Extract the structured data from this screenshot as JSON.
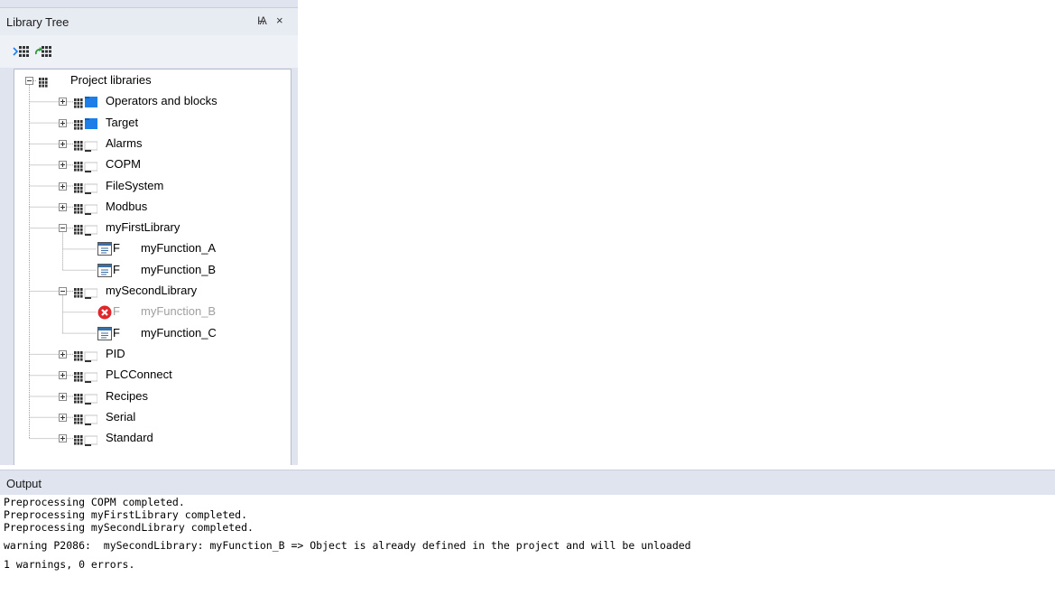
{
  "library_tree": {
    "title": "Library Tree",
    "pin_glyph": "Ѩ",
    "close_glyph": "×",
    "toolbar": [
      {
        "icon": "import-library-icon"
      },
      {
        "icon": "refresh-library-icon"
      }
    ],
    "root": {
      "label": "Project libraries",
      "expanded": true
    },
    "items": [
      {
        "label": "Operators and blocks",
        "state": "collapsed",
        "icon": "library-blue"
      },
      {
        "label": "Target",
        "state": "collapsed",
        "icon": "library-blue"
      },
      {
        "label": "Alarms",
        "state": "collapsed",
        "icon": "library-gray"
      },
      {
        "label": "COPM",
        "state": "collapsed",
        "icon": "library-gray"
      },
      {
        "label": "FileSystem",
        "state": "collapsed",
        "icon": "library-gray"
      },
      {
        "label": "Modbus",
        "state": "collapsed",
        "icon": "library-gray"
      },
      {
        "label": "myFirstLibrary",
        "state": "expanded",
        "icon": "library-gray",
        "children": [
          {
            "label": "myFunction_A",
            "kind": "F",
            "status": "ok"
          },
          {
            "label": "myFunction_B",
            "kind": "F",
            "status": "ok"
          }
        ]
      },
      {
        "label": "mySecondLibrary",
        "state": "expanded",
        "icon": "library-gray",
        "children": [
          {
            "label": "myFunction_B",
            "kind": "F",
            "status": "error"
          },
          {
            "label": "myFunction_C",
            "kind": "F",
            "status": "ok"
          }
        ]
      },
      {
        "label": "PID",
        "state": "collapsed",
        "icon": "library-gray"
      },
      {
        "label": "PLCConnect",
        "state": "collapsed",
        "icon": "library-gray"
      },
      {
        "label": "Recipes",
        "state": "collapsed",
        "icon": "library-gray"
      },
      {
        "label": "Serial",
        "state": "collapsed",
        "icon": "library-gray"
      },
      {
        "label": "Standard",
        "state": "collapsed",
        "icon": "library-gray"
      }
    ]
  },
  "output": {
    "title": "Output",
    "lines": [
      "Preprocessing COPM completed.",
      "Preprocessing myFirstLibrary completed.",
      "Preprocessing mySecondLibrary completed.",
      "",
      "warning P2086:  mySecondLibrary: myFunction_B => Object is already defined in the project and will be unloaded",
      "",
      "1 warnings, 0 errors."
    ]
  },
  "colors": {
    "panel_bg": "#dfe4ee",
    "library_blue": "#1e7ee8",
    "error_red": "#e0262b",
    "disabled_text": "#a0a0a0"
  }
}
